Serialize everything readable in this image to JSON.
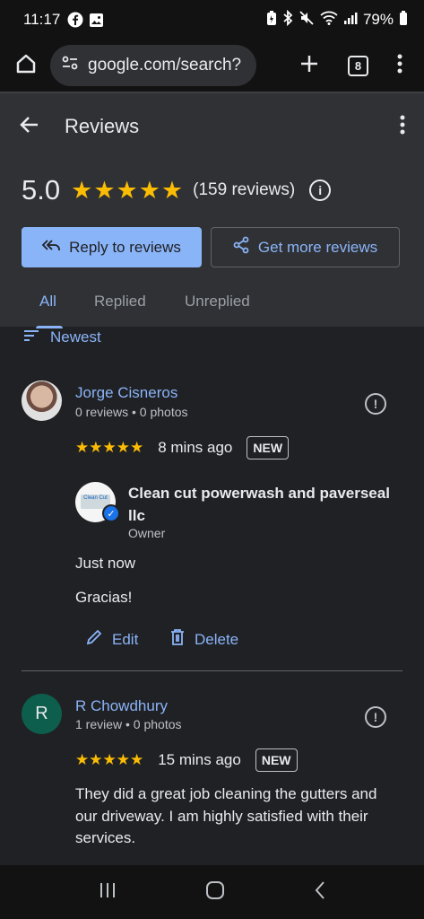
{
  "status_bar": {
    "time": "11:17",
    "battery": "79%",
    "icons": [
      "facebook-icon",
      "gallery-icon",
      "battery-saver-icon",
      "bluetooth-icon",
      "mute-icon",
      "wifi-icon",
      "signal-icon",
      "battery-icon"
    ]
  },
  "browser": {
    "url": "google.com/search?",
    "tab_count": "8"
  },
  "header": {
    "title": "Reviews",
    "rating": "5.0",
    "stars": "★★★★★",
    "review_count": "(159 reviews)",
    "reply_button": "Reply to reviews",
    "more_reviews_button": "Get more reviews"
  },
  "tabs": [
    {
      "label": "All",
      "active": true
    },
    {
      "label": "Replied",
      "active": false
    },
    {
      "label": "Unreplied",
      "active": false
    }
  ],
  "sort": {
    "label": "Newest"
  },
  "reviews": [
    {
      "name": "Jorge Cisneros",
      "meta": "0 reviews • 0 photos",
      "stars": "★★★★★",
      "time": "8 mins ago",
      "badge": "NEW",
      "owner_reply": {
        "owner_name": "Clean cut powerwash and paverseal llc",
        "role": "Owner",
        "time": "Just now",
        "text": "Gracias!"
      },
      "edit_label": "Edit",
      "delete_label": "Delete"
    },
    {
      "name": "R Chowdhury",
      "avatar_letter": "R",
      "meta": "1 review • 0 photos",
      "stars": "★★★★★",
      "time": "15 mins ago",
      "badge": "NEW",
      "text": "They did a great job cleaning the gutters and our driveway. I am highly satisfied with their services."
    }
  ],
  "colors": {
    "accent": "#8ab4f8",
    "star": "#fbbc04",
    "background": "#202124",
    "header_bg": "#303134"
  }
}
